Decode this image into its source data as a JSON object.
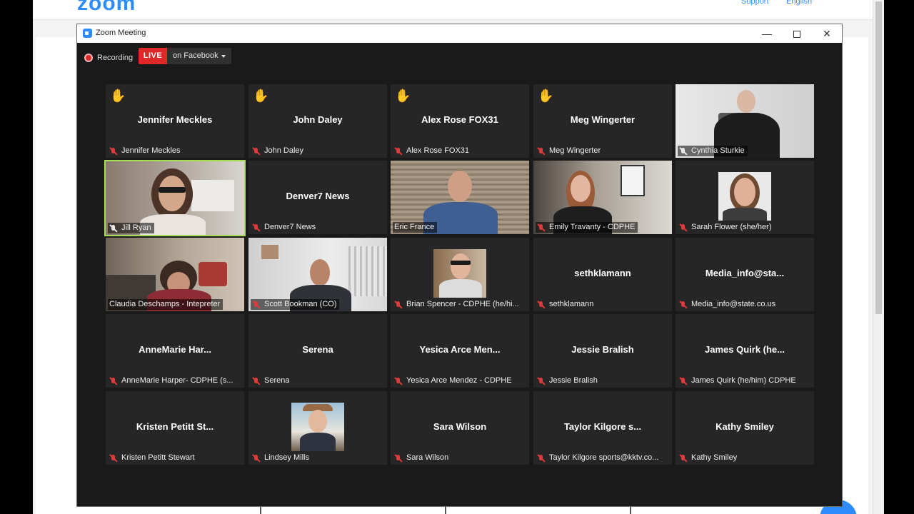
{
  "website": {
    "logo": "zoom",
    "links": [
      "Support",
      "English"
    ]
  },
  "window": {
    "title": "Zoom Meeting",
    "minimize": "—",
    "close": "✕"
  },
  "recording": {
    "label": "Recording",
    "live": "LIVE",
    "destination": "on Facebook"
  },
  "colors": {
    "accent": "#2d8cff",
    "live": "#e02828",
    "speaker_border": "#a6dd55",
    "raise_hand": "#f4c20d"
  },
  "participants": [
    {
      "name": "Jennifer Meckles",
      "label": "Jennifer Meckles",
      "hand": true,
      "video": false,
      "muted": true
    },
    {
      "name": "John Daley",
      "label": "John Daley",
      "hand": true,
      "video": false,
      "muted": true
    },
    {
      "name": "Alex Rose FOX31",
      "label": "Alex Rose FOX31",
      "hand": true,
      "video": false,
      "muted": true
    },
    {
      "name": "Meg Wingerter",
      "label": "Meg Wingerter",
      "hand": true,
      "video": false,
      "muted": true
    },
    {
      "name": "Cynthia Sturkie",
      "label": "Cynthia Sturkie",
      "hand": false,
      "video": true,
      "muted": false
    },
    {
      "name": "Jill Ryan",
      "label": "Jill Ryan",
      "hand": false,
      "video": true,
      "muted": false,
      "active_speaker": true
    },
    {
      "name": "Denver7 News",
      "label": "Denver7 News",
      "hand": false,
      "video": false,
      "muted": true
    },
    {
      "name": "Eric France",
      "label": "Eric France",
      "hand": false,
      "video": true,
      "muted": false
    },
    {
      "name": "Emily Travanty - CDPHE",
      "label": "Emily Travanty - CDPHE",
      "hand": false,
      "video": true,
      "muted": true
    },
    {
      "name": "Sarah Flower (she/her)",
      "label": "Sarah Flower (she/her)",
      "hand": false,
      "video": true,
      "muted": true
    },
    {
      "name": "Claudia Deschamps - Intepreter",
      "label": "Claudia Deschamps - Intepreter",
      "hand": false,
      "video": true,
      "muted": false
    },
    {
      "name": "Scott Bookman (CO)",
      "label": "Scott Bookman (CO)",
      "hand": false,
      "video": true,
      "muted": true
    },
    {
      "name": "Brian Spencer - CDPHE (he/hi...",
      "label": "Brian Spencer - CDPHE (he/hi...",
      "hand": false,
      "video": true,
      "muted": true
    },
    {
      "name": "sethklamann",
      "label": "sethklamann",
      "hand": false,
      "video": false,
      "muted": true
    },
    {
      "name": "Media_info@sta...",
      "label": "Media_info@state.co.us",
      "hand": false,
      "video": false,
      "muted": true
    },
    {
      "name": "AnneMarie Har...",
      "label": "AnneMarie Harper- CDPHE (s...",
      "hand": false,
      "video": false,
      "muted": true
    },
    {
      "name": "Serena",
      "label": "Serena",
      "hand": false,
      "video": false,
      "muted": true
    },
    {
      "name": "Yesica Arce Men...",
      "label": "Yesica Arce Mendez - CDPHE",
      "hand": false,
      "video": false,
      "muted": true
    },
    {
      "name": "Jessie Bralish",
      "label": "Jessie Bralish",
      "hand": false,
      "video": false,
      "muted": true
    },
    {
      "name": "James Quirk (he...",
      "label": "James Quirk (he/him) CDPHE",
      "hand": false,
      "video": false,
      "muted": true
    },
    {
      "name": "Kristen Petitt St...",
      "label": "Kristen Petitt Stewart",
      "hand": false,
      "video": false,
      "muted": true
    },
    {
      "name": "Lindsey Mills",
      "label": "Lindsey Mills",
      "hand": false,
      "video": true,
      "muted": true
    },
    {
      "name": "Sara Wilson",
      "label": "Sara Wilson",
      "hand": false,
      "video": false,
      "muted": true
    },
    {
      "name": "Taylor Kilgore s...",
      "label": "Taylor Kilgore sports@kktv.co...",
      "hand": false,
      "video": false,
      "muted": true
    },
    {
      "name": "Kathy Smiley",
      "label": "Kathy Smiley",
      "hand": false,
      "video": false,
      "muted": true
    }
  ]
}
